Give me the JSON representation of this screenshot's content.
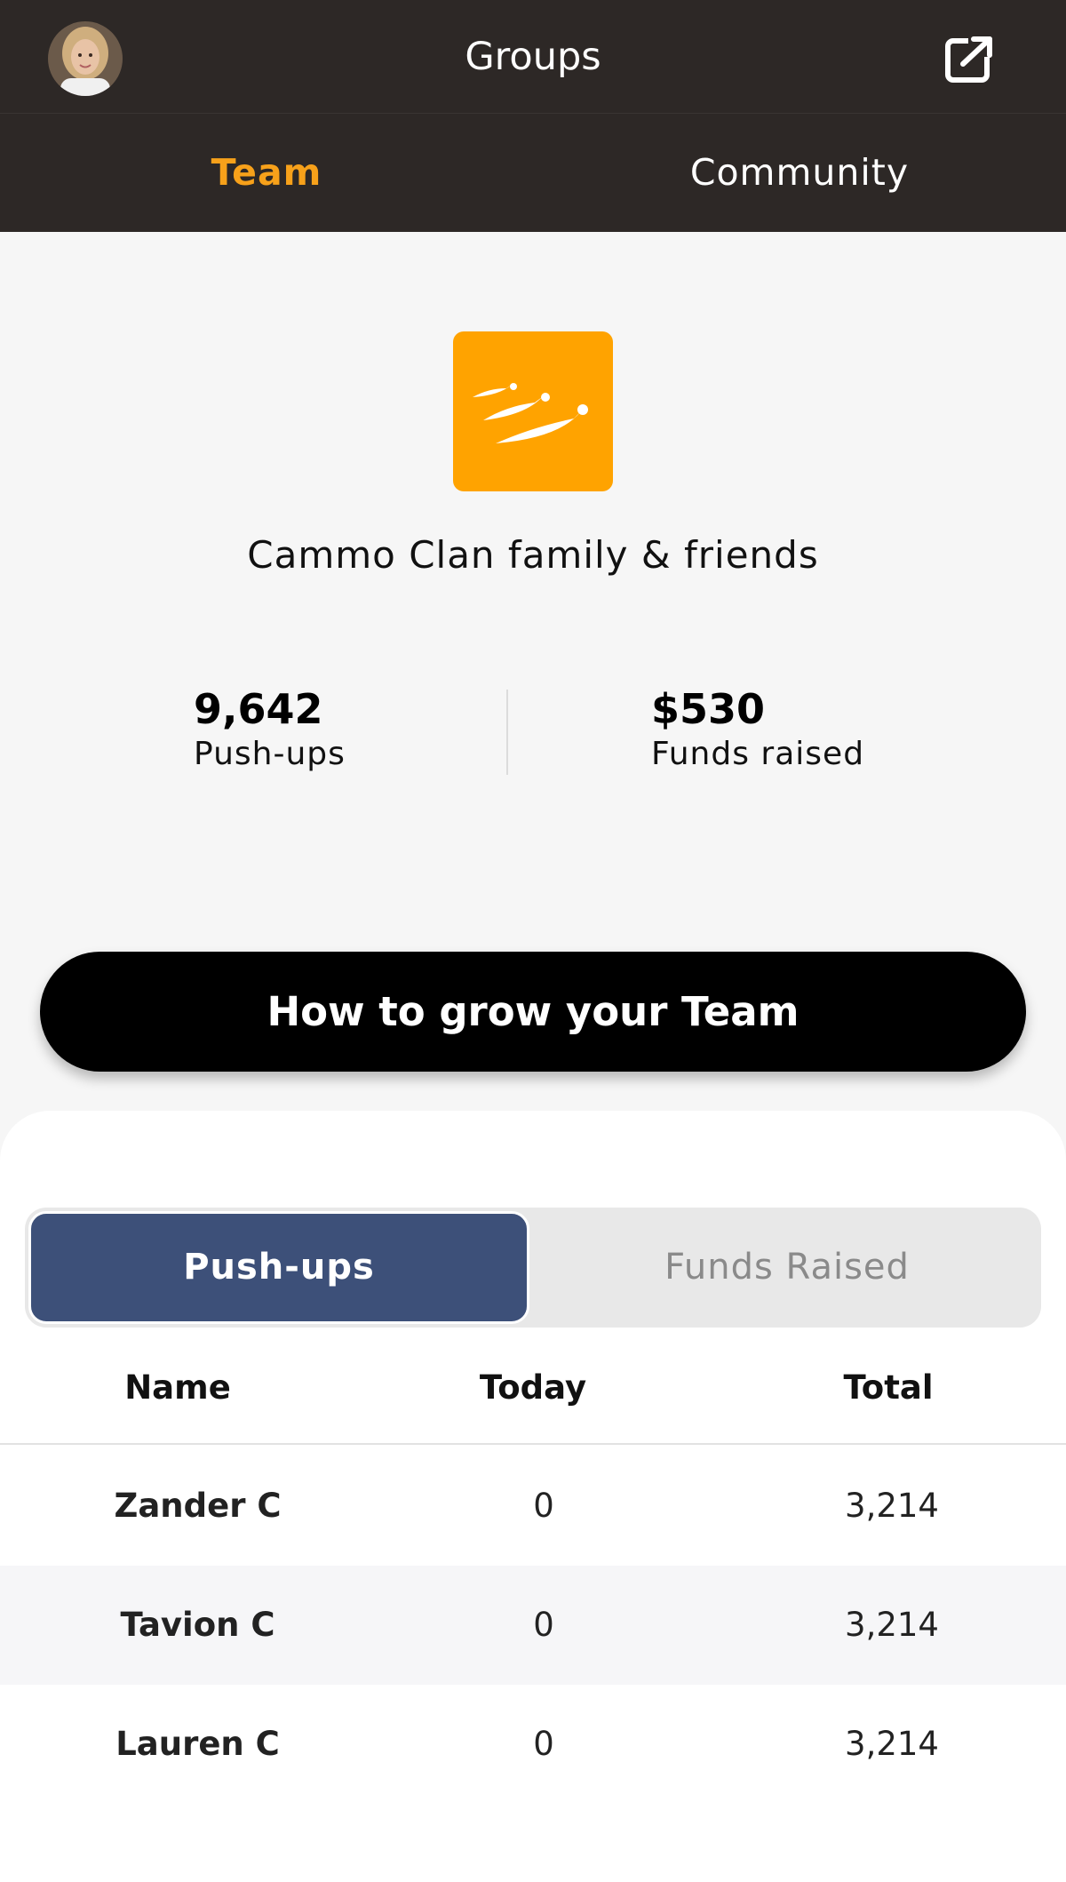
{
  "header": {
    "title": "Groups",
    "avatar_icon": "user-avatar",
    "action_icon": "external-link-icon"
  },
  "tabs": [
    {
      "label": "Team",
      "active": true
    },
    {
      "label": "Community",
      "active": false
    }
  ],
  "colors": {
    "header_bg": "#2d2826",
    "accent": "#f7a11a",
    "logo_bg": "#ffa300",
    "segment_active": "#3d5079"
  },
  "group": {
    "logo_icon": "running-figures-logo",
    "name": "Cammo Clan family & friends",
    "stats": {
      "pushups_value": "9,642",
      "pushups_label": "Push-ups",
      "funds_value": "$530",
      "funds_label": "Funds raised"
    }
  },
  "grow_button_label": "How to grow your Team",
  "leaderboard": {
    "segments": [
      "Push-ups",
      "Funds Raised"
    ],
    "active_segment": "Push-ups",
    "columns": [
      "Name",
      "Today",
      "Total"
    ],
    "rows": [
      {
        "name": "Zander C",
        "today": "0",
        "total": "3,214"
      },
      {
        "name": "Tavion C",
        "today": "0",
        "total": "3,214"
      },
      {
        "name": "Lauren C",
        "today": "0",
        "total": "3,214"
      }
    ]
  }
}
